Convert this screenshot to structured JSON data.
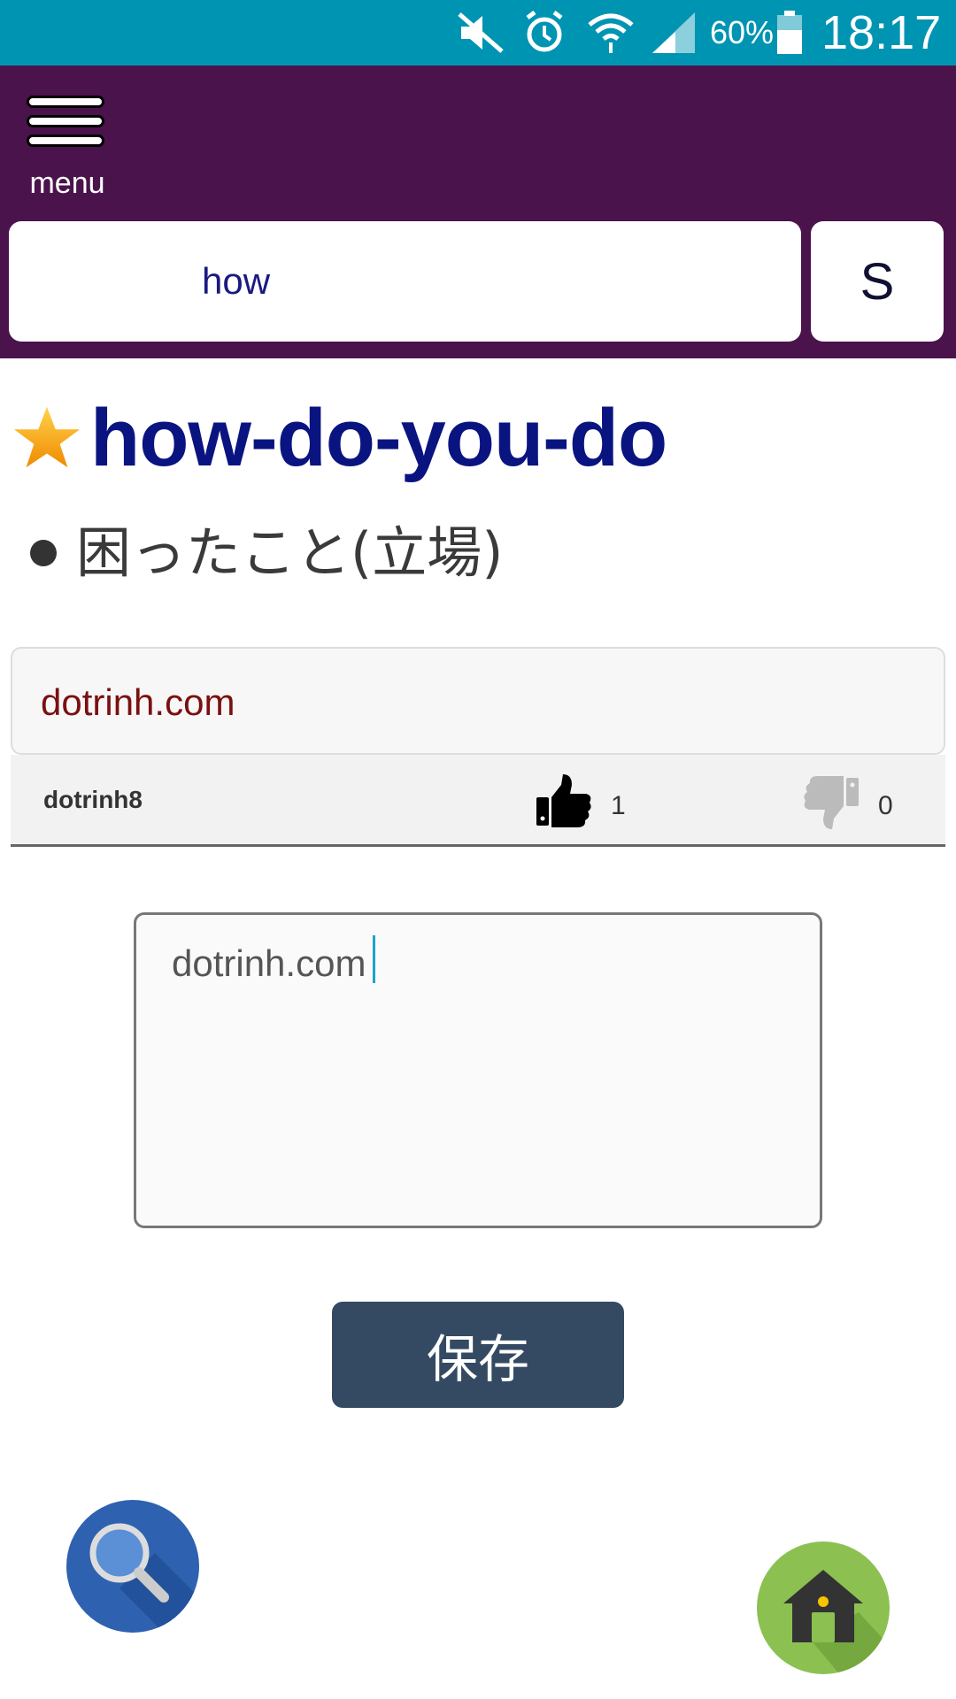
{
  "status_bar": {
    "battery_percent": "60%",
    "time": "18:17",
    "icons": [
      "mute-icon",
      "alarm-icon",
      "wifi-icon",
      "signal-icon",
      "battery-icon"
    ]
  },
  "header": {
    "menu_label": "menu",
    "search_value": "how",
    "search_button_label": "S"
  },
  "entry": {
    "word": "how-do-you-do",
    "meaning": "困ったこと(立場)"
  },
  "comment": {
    "text": "dotrinh.com",
    "author": "dotrinh8",
    "likes": "1",
    "dislikes": "0"
  },
  "editor": {
    "value": "dotrinh.com",
    "save_label": "保存"
  },
  "colors": {
    "status_bar": "#0094b3",
    "header": "#4b134b",
    "title": "#0a1480",
    "comment_text": "#7a1010",
    "save_button": "#344a62",
    "fab_search": "#2e62b0",
    "fab_home": "#8cc152"
  }
}
